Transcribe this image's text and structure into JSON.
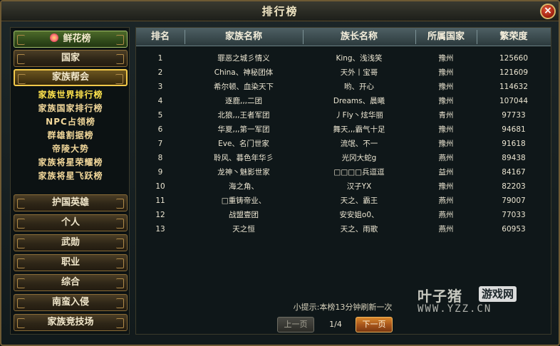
{
  "window": {
    "title": "排行榜",
    "close_label": "×"
  },
  "sidebar": {
    "flower_label": "鲜花榜",
    "nation_label": "国家",
    "family_label": "家族帮会",
    "sub_items": [
      "家族世界排行榜",
      "家族国家排行榜",
      "NPC占领榜",
      "群雄割据榜",
      "帝陵大势",
      "家族将星荣耀榜",
      "家族将星飞跃榜"
    ],
    "bottom_items": [
      "护国英雄",
      "个人",
      "武勋",
      "职业",
      "综合",
      "南蛮入侵",
      "家族竞技场"
    ]
  },
  "table": {
    "headers": [
      "排名",
      "家族名称",
      "族长名称",
      "所属国家",
      "繁荣度"
    ],
    "rows": [
      [
        "1",
        "罪恶之城彡情义",
        "King、浅浅笑",
        "豫州",
        "125660"
      ],
      [
        "2",
        "China、神秘团体",
        "天外丨宝哥",
        "豫州",
        "121609"
      ],
      [
        "3",
        "希尔顿、血染天下",
        "哟、开心",
        "豫州",
        "114632"
      ],
      [
        "4",
        "逐鹿,,,二团",
        "Dreams、晨曦",
        "豫州",
        "107044"
      ],
      [
        "5",
        "北狼,,,王者军团",
        "丿Fly丶炫华丽",
        "青州",
        "97733"
      ],
      [
        "6",
        "华夏,,,第一军团",
        "舞天,,,霸气十足",
        "豫州",
        "94681"
      ],
      [
        "7",
        "Eve、名门世家",
        "流氓、不一",
        "豫州",
        "91618"
      ],
      [
        "8",
        "聆风、暮色年华彡",
        "光冈大蛇g",
        "燕州",
        "89438"
      ],
      [
        "9",
        "龙神丶魅影世家",
        "□□□□兵逗逗",
        "益州",
        "84167"
      ],
      [
        "10",
        "海之角、",
        "汉子YX",
        "豫州",
        "82203"
      ],
      [
        "11",
        "□重铸帝业、",
        "天之、霸王",
        "燕州",
        "79007"
      ],
      [
        "12",
        "战盟壹团",
        "安安姐o0、",
        "燕州",
        "77033"
      ],
      [
        "13",
        "天之恒",
        "天之、雨歌",
        "燕州",
        "60953"
      ]
    ]
  },
  "footer": {
    "hint": "小提示:本榜13分钟刷新一次",
    "prev_label": "上一页",
    "page": "1/4",
    "next_label": "下一页"
  },
  "watermark": {
    "logo": "叶子猪",
    "badge": "游戏网",
    "url": "WWW.YZZ.CN"
  }
}
